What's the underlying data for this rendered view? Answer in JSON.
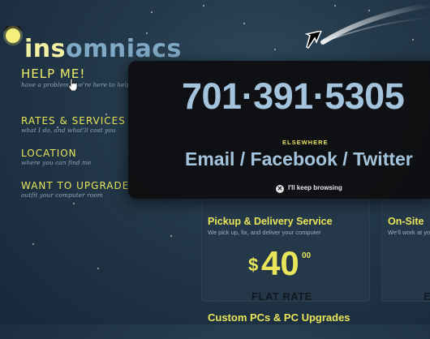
{
  "logo": {
    "text_hl": "ins",
    "text_rest": "omniacs"
  },
  "nav": {
    "items": [
      {
        "title": "HELP ME!",
        "sub": "have a problem? we're here to help"
      },
      {
        "title": "RATES & SERVICES",
        "sub": "what I do, and what'll cost you"
      },
      {
        "title": "LOCATION",
        "sub": "where you can find me"
      },
      {
        "title": "WANT TO UPGRADE",
        "sub": "outfit your computer room"
      }
    ]
  },
  "cards": {
    "pickup": {
      "title": "Pickup & Delivery Service",
      "desc": "We pick up, fix, and deliver your computer",
      "price_currency": "$",
      "price_amount": "40",
      "price_cents": "00",
      "flat_label": "FLAT RATE"
    },
    "onsite": {
      "title": "On-Site",
      "desc": "We'll work at yo",
      "flat_label": "E"
    },
    "custom": {
      "title": "Custom PCs & PC Upgrades"
    }
  },
  "modal": {
    "phone": "701·391·5305",
    "elsewhere_label": "ELSEWHERE",
    "contacts": "Email / Facebook / Twitter",
    "dismiss_label": "I'll keep browsing",
    "dismiss_icon": "close-circle-icon"
  },
  "colors": {
    "accent_yellow": "#e8e55a",
    "phone_blue": "#a3c4dc",
    "background": "#223748"
  }
}
